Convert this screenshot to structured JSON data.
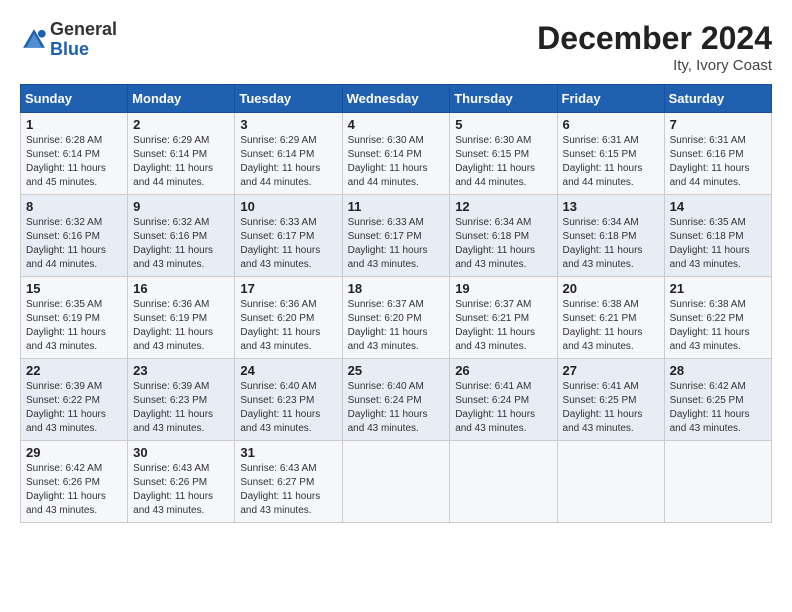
{
  "header": {
    "logo_general": "General",
    "logo_blue": "Blue",
    "month_year": "December 2024",
    "location": "Ity, Ivory Coast"
  },
  "days_of_week": [
    "Sunday",
    "Monday",
    "Tuesday",
    "Wednesday",
    "Thursday",
    "Friday",
    "Saturday"
  ],
  "weeks": [
    [
      {
        "day": "1",
        "sunrise": "6:28 AM",
        "sunset": "6:14 PM",
        "daylight": "11 hours and 45 minutes."
      },
      {
        "day": "2",
        "sunrise": "6:29 AM",
        "sunset": "6:14 PM",
        "daylight": "11 hours and 44 minutes."
      },
      {
        "day": "3",
        "sunrise": "6:29 AM",
        "sunset": "6:14 PM",
        "daylight": "11 hours and 44 minutes."
      },
      {
        "day": "4",
        "sunrise": "6:30 AM",
        "sunset": "6:14 PM",
        "daylight": "11 hours and 44 minutes."
      },
      {
        "day": "5",
        "sunrise": "6:30 AM",
        "sunset": "6:15 PM",
        "daylight": "11 hours and 44 minutes."
      },
      {
        "day": "6",
        "sunrise": "6:31 AM",
        "sunset": "6:15 PM",
        "daylight": "11 hours and 44 minutes."
      },
      {
        "day": "7",
        "sunrise": "6:31 AM",
        "sunset": "6:16 PM",
        "daylight": "11 hours and 44 minutes."
      }
    ],
    [
      {
        "day": "8",
        "sunrise": "6:32 AM",
        "sunset": "6:16 PM",
        "daylight": "11 hours and 44 minutes."
      },
      {
        "day": "9",
        "sunrise": "6:32 AM",
        "sunset": "6:16 PM",
        "daylight": "11 hours and 43 minutes."
      },
      {
        "day": "10",
        "sunrise": "6:33 AM",
        "sunset": "6:17 PM",
        "daylight": "11 hours and 43 minutes."
      },
      {
        "day": "11",
        "sunrise": "6:33 AM",
        "sunset": "6:17 PM",
        "daylight": "11 hours and 43 minutes."
      },
      {
        "day": "12",
        "sunrise": "6:34 AM",
        "sunset": "6:18 PM",
        "daylight": "11 hours and 43 minutes."
      },
      {
        "day": "13",
        "sunrise": "6:34 AM",
        "sunset": "6:18 PM",
        "daylight": "11 hours and 43 minutes."
      },
      {
        "day": "14",
        "sunrise": "6:35 AM",
        "sunset": "6:18 PM",
        "daylight": "11 hours and 43 minutes."
      }
    ],
    [
      {
        "day": "15",
        "sunrise": "6:35 AM",
        "sunset": "6:19 PM",
        "daylight": "11 hours and 43 minutes."
      },
      {
        "day": "16",
        "sunrise": "6:36 AM",
        "sunset": "6:19 PM",
        "daylight": "11 hours and 43 minutes."
      },
      {
        "day": "17",
        "sunrise": "6:36 AM",
        "sunset": "6:20 PM",
        "daylight": "11 hours and 43 minutes."
      },
      {
        "day": "18",
        "sunrise": "6:37 AM",
        "sunset": "6:20 PM",
        "daylight": "11 hours and 43 minutes."
      },
      {
        "day": "19",
        "sunrise": "6:37 AM",
        "sunset": "6:21 PM",
        "daylight": "11 hours and 43 minutes."
      },
      {
        "day": "20",
        "sunrise": "6:38 AM",
        "sunset": "6:21 PM",
        "daylight": "11 hours and 43 minutes."
      },
      {
        "day": "21",
        "sunrise": "6:38 AM",
        "sunset": "6:22 PM",
        "daylight": "11 hours and 43 minutes."
      }
    ],
    [
      {
        "day": "22",
        "sunrise": "6:39 AM",
        "sunset": "6:22 PM",
        "daylight": "11 hours and 43 minutes."
      },
      {
        "day": "23",
        "sunrise": "6:39 AM",
        "sunset": "6:23 PM",
        "daylight": "11 hours and 43 minutes."
      },
      {
        "day": "24",
        "sunrise": "6:40 AM",
        "sunset": "6:23 PM",
        "daylight": "11 hours and 43 minutes."
      },
      {
        "day": "25",
        "sunrise": "6:40 AM",
        "sunset": "6:24 PM",
        "daylight": "11 hours and 43 minutes."
      },
      {
        "day": "26",
        "sunrise": "6:41 AM",
        "sunset": "6:24 PM",
        "daylight": "11 hours and 43 minutes."
      },
      {
        "day": "27",
        "sunrise": "6:41 AM",
        "sunset": "6:25 PM",
        "daylight": "11 hours and 43 minutes."
      },
      {
        "day": "28",
        "sunrise": "6:42 AM",
        "sunset": "6:25 PM",
        "daylight": "11 hours and 43 minutes."
      }
    ],
    [
      {
        "day": "29",
        "sunrise": "6:42 AM",
        "sunset": "6:26 PM",
        "daylight": "11 hours and 43 minutes."
      },
      {
        "day": "30",
        "sunrise": "6:43 AM",
        "sunset": "6:26 PM",
        "daylight": "11 hours and 43 minutes."
      },
      {
        "day": "31",
        "sunrise": "6:43 AM",
        "sunset": "6:27 PM",
        "daylight": "11 hours and 43 minutes."
      },
      null,
      null,
      null,
      null
    ]
  ],
  "labels": {
    "sunrise": "Sunrise: ",
    "sunset": "Sunset: ",
    "daylight": "Daylight: "
  }
}
